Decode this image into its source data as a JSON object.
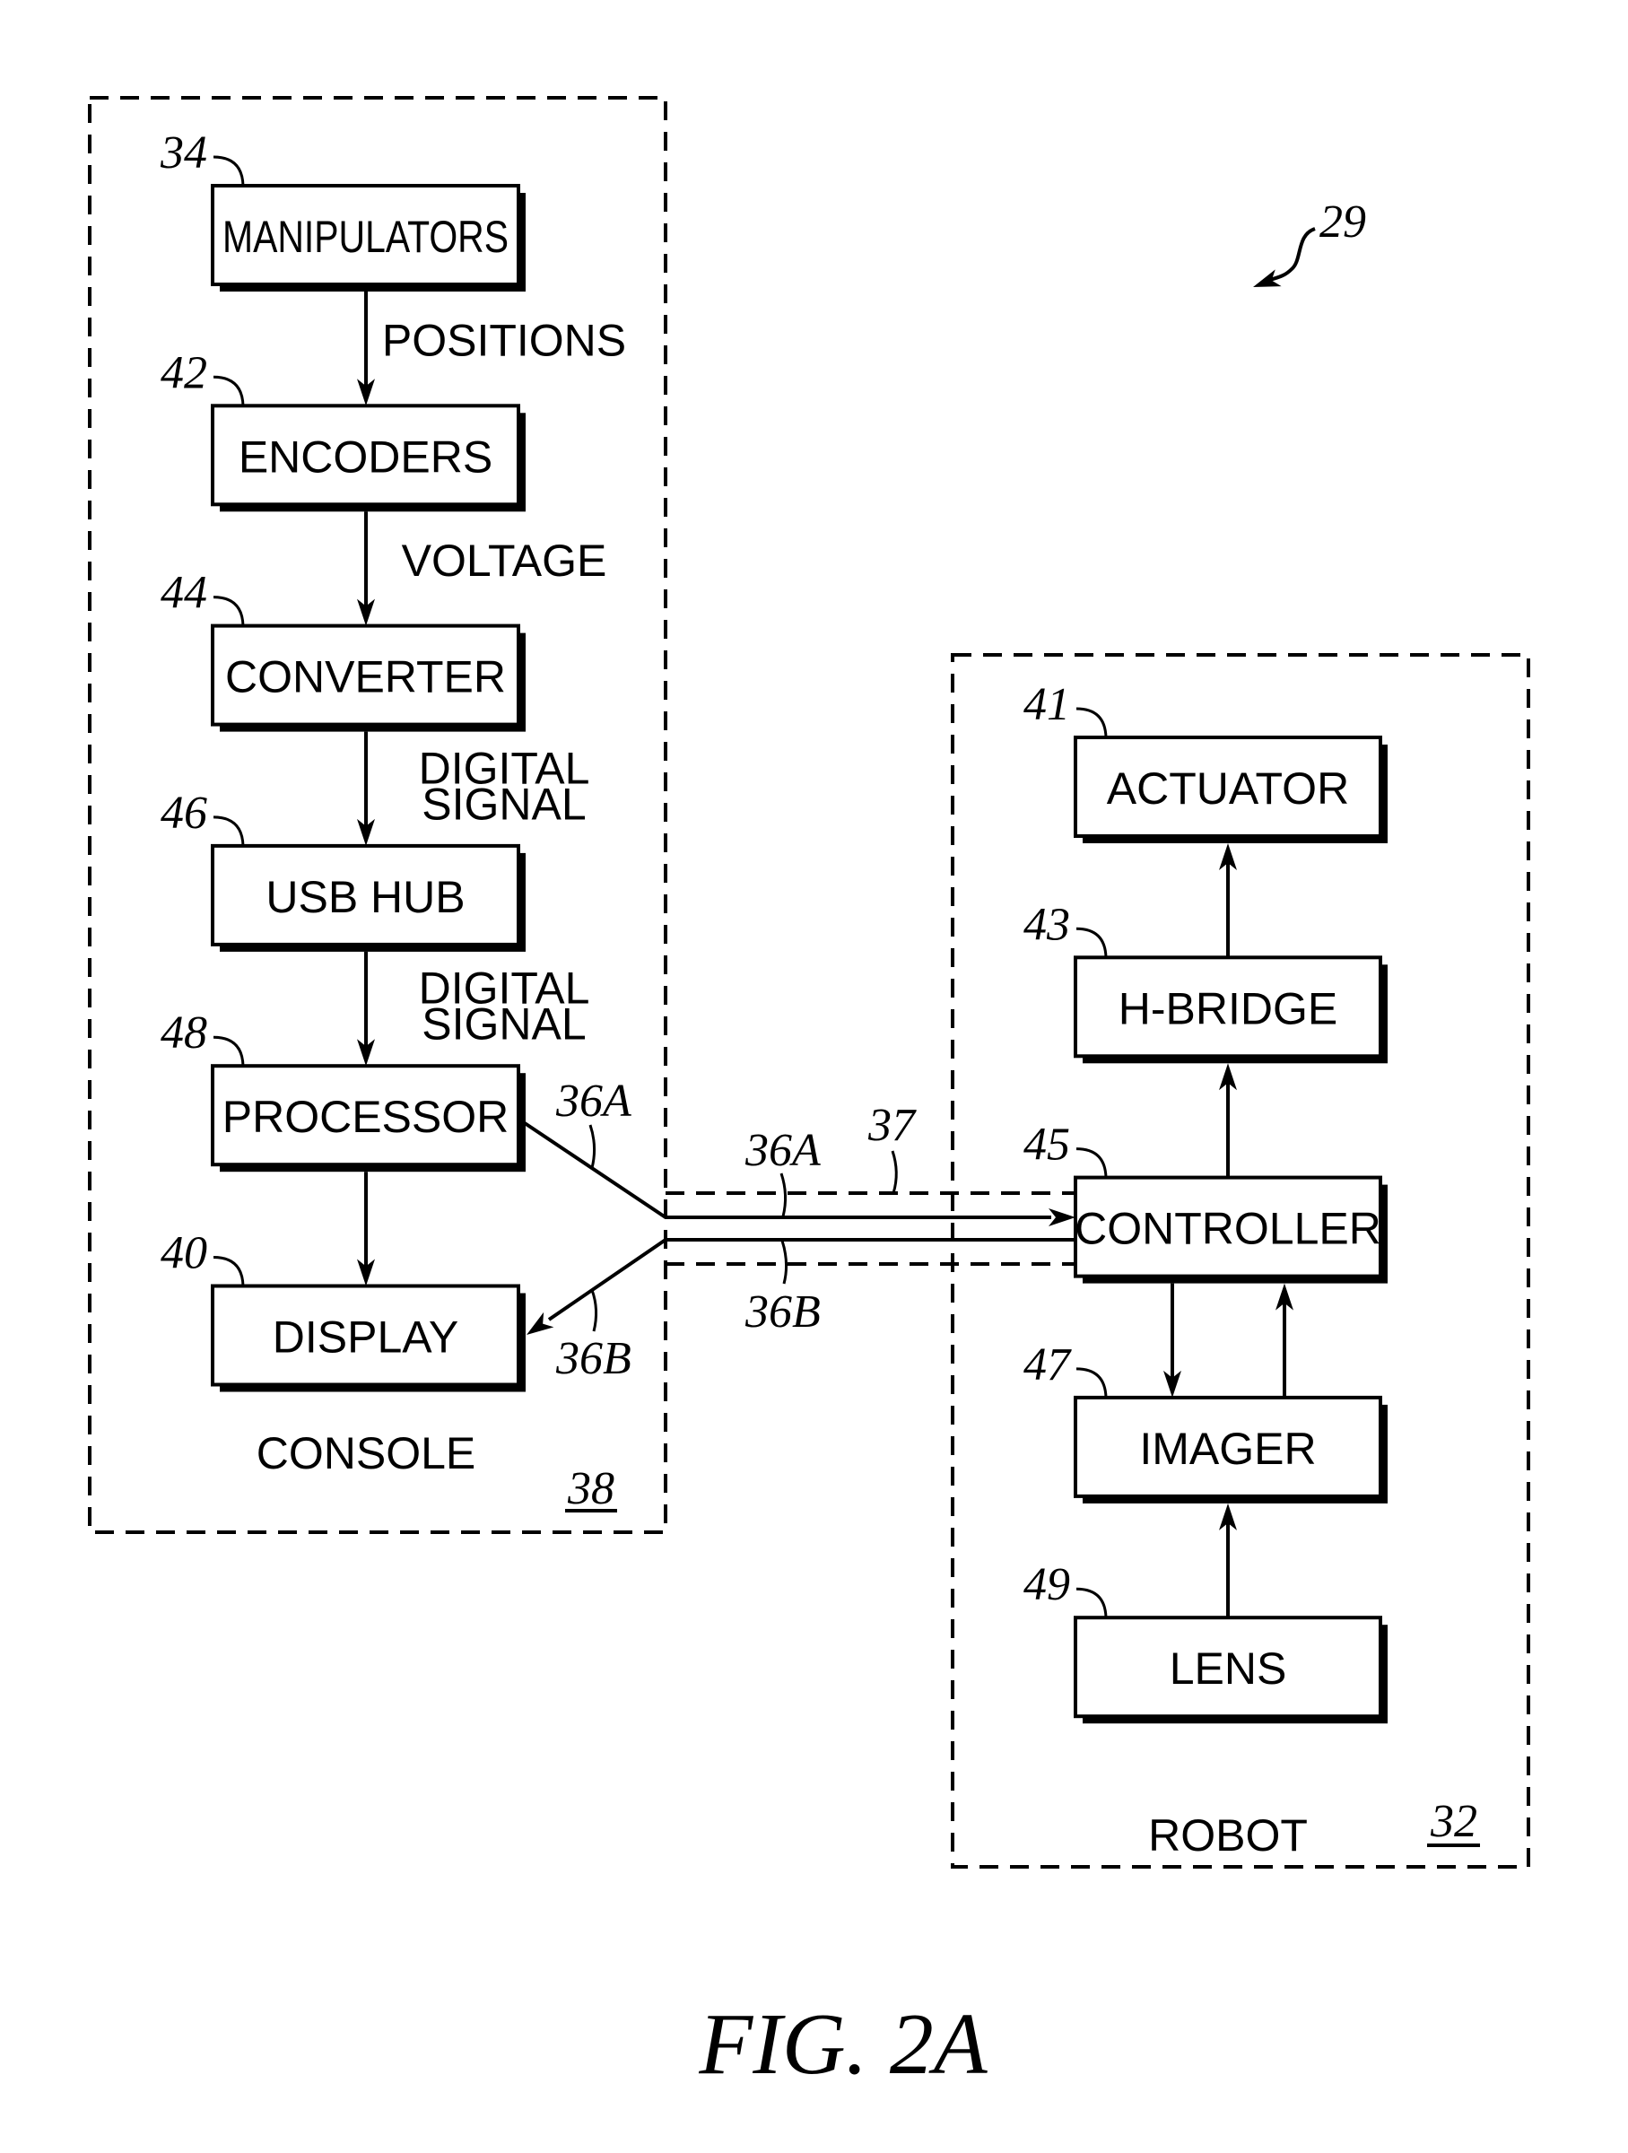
{
  "figure": {
    "caption": "FIG. 2A",
    "system_ref": "29"
  },
  "console": {
    "name": "CONSOLE",
    "ref": "38",
    "blocks": [
      {
        "id": "manipulators",
        "label": "MANIPULATORS",
        "ref": "34"
      },
      {
        "id": "encoders",
        "label": "ENCODERS",
        "ref": "42"
      },
      {
        "id": "converter",
        "label": "CONVERTER",
        "ref": "44"
      },
      {
        "id": "usb-hub",
        "label": "USB HUB",
        "ref": "46"
      },
      {
        "id": "processor",
        "label": "PROCESSOR",
        "ref": "48"
      },
      {
        "id": "display",
        "label": "DISPLAY",
        "ref": "40"
      }
    ],
    "flows": [
      {
        "lines": [
          "POSITIONS"
        ]
      },
      {
        "lines": [
          "VOLTAGE"
        ]
      },
      {
        "lines": [
          "DIGITAL",
          "SIGNAL"
        ]
      },
      {
        "lines": [
          "DIGITAL",
          "SIGNAL"
        ]
      }
    ]
  },
  "robot": {
    "name": "ROBOT",
    "ref": "32",
    "blocks": [
      {
        "id": "actuator",
        "label": "ACTUATOR",
        "ref": "41"
      },
      {
        "id": "h-bridge",
        "label": "H-BRIDGE",
        "ref": "43"
      },
      {
        "id": "controller",
        "label": "CONTROLLER",
        "ref": "45"
      },
      {
        "id": "imager",
        "label": "IMAGER",
        "ref": "47"
      },
      {
        "id": "lens",
        "label": "LENS",
        "ref": "49"
      }
    ]
  },
  "cable": {
    "ref": "37",
    "line_a_ref": "36A",
    "line_b_ref": "36B"
  }
}
